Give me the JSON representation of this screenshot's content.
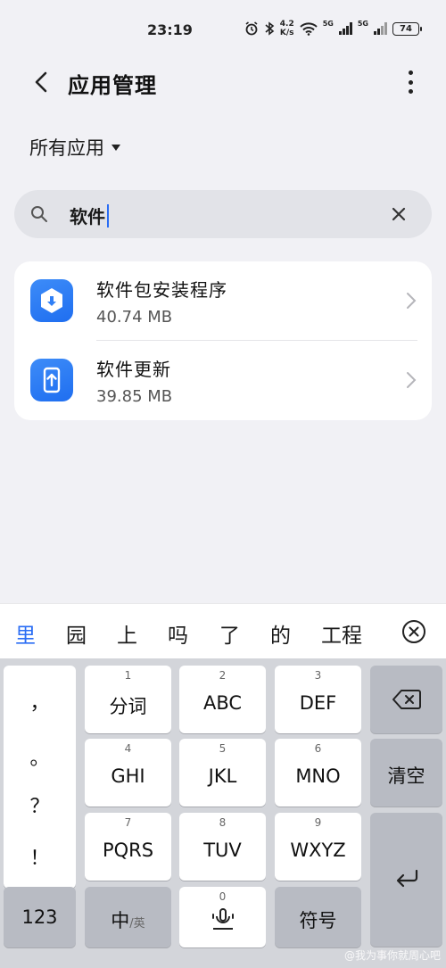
{
  "status_bar": {
    "time": "23:19",
    "net_speed_value": "4.2",
    "net_speed_unit": "K/s",
    "sim1_gen": "5G",
    "sim2_gen": "5G",
    "battery": "74"
  },
  "header": {
    "title": "应用管理"
  },
  "filter": {
    "label": "所有应用"
  },
  "search": {
    "value": "软件"
  },
  "results": [
    {
      "name": "软件包安装程序",
      "size": "40.74 MB",
      "icon": "package-installer-icon"
    },
    {
      "name": "软件更新",
      "size": "39.85 MB",
      "icon": "software-update-icon"
    }
  ],
  "candidates": [
    "里",
    "园",
    "上",
    "吗",
    "了",
    "的",
    "工程"
  ],
  "keyboard": {
    "punctuation": [
      "，",
      "。",
      "？",
      "！"
    ],
    "keys": [
      {
        "num": "1",
        "label": "分词"
      },
      {
        "num": "2",
        "label": "ABC"
      },
      {
        "num": "3",
        "label": "DEF"
      },
      {
        "num": "4",
        "label": "GHI"
      },
      {
        "num": "5",
        "label": "JKL"
      },
      {
        "num": "6",
        "label": "MNO"
      },
      {
        "num": "7",
        "label": "PQRS"
      },
      {
        "num": "8",
        "label": "TUV"
      },
      {
        "num": "9",
        "label": "WXYZ"
      }
    ],
    "clear_label": "清空",
    "num_switch": "123",
    "lang_main": "中",
    "lang_sub": "/英",
    "space_num": "0",
    "symbol_label": "符号"
  },
  "watermark": "@我为事你就周心吧",
  "colors": {
    "accent": "#2a6df4",
    "app_icon": "#2f7ff6",
    "background": "#f1f1f5"
  }
}
